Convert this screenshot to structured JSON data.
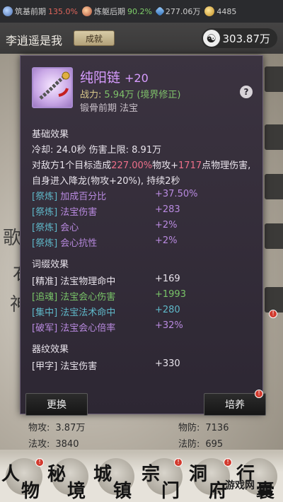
{
  "resources": [
    {
      "icon": "cultivation-stage-icon",
      "label": "筑基前期",
      "pct": "135.0%",
      "pct_color": "#e0665c"
    },
    {
      "icon": "body-refine-icon",
      "label": "炼躯后期",
      "pct": "90.2%",
      "pct_color": "#7fcf6a"
    },
    {
      "icon": "spirit-stone-icon",
      "label": "277.06万",
      "pct": "",
      "pct_color": ""
    },
    {
      "icon": "gold-coin-icon",
      "label": "4485",
      "pct": "",
      "pct_color": ""
    }
  ],
  "player": {
    "name": "李逍遥是我",
    "achievement_label": "成就",
    "power_value": "303.87万"
  },
  "item": {
    "name": "纯阳链",
    "level": "+20",
    "power_label": "战力:",
    "power_value": "5.94万",
    "power_note": "(境界修正)",
    "type_line": "锻骨前期  法宝",
    "help": "?"
  },
  "basic": {
    "title": "基础效果",
    "line1_prefix": "冷却:",
    "cooldown": "24.0秒",
    "damage_cap_label": "伤害上限:",
    "damage_cap": "8.91万",
    "desc_a": "对敌方1个目标造成",
    "desc_pct": "227.00%",
    "desc_b": "物攻+",
    "desc_flat": "1717",
    "desc_c": "点物理伤害,",
    "desc2": "自身进入降龙(物攻+20%), 持续2秒"
  },
  "refine_rows": [
    {
      "tag": "[祭炼]",
      "name": "加成百分比",
      "value": "+37.50%"
    },
    {
      "tag": "[祭炼]",
      "name": "法宝伤害",
      "value": "+283"
    },
    {
      "tag": "[祭炼]",
      "name": "会心",
      "value": "+2%"
    },
    {
      "tag": "[祭炼]",
      "name": "会心抗性",
      "value": "+2%"
    }
  ],
  "affix": {
    "title": "词缀效果",
    "rows": [
      {
        "tag": "[精准]",
        "name": "法宝物理命中",
        "value": "+169"
      },
      {
        "tag": "[追魂]",
        "name": "法宝会心伤害",
        "value": "+1993"
      },
      {
        "tag": "[集中]",
        "name": "法宝法术命中",
        "value": "+280"
      },
      {
        "tag": "[破军]",
        "name": "法宝会心倍率",
        "value": "+32%"
      }
    ]
  },
  "pattern": {
    "title": "器纹效果",
    "rows": [
      {
        "tag": "[甲字]",
        "name": "法宝伤害",
        "value": "+330"
      }
    ]
  },
  "buttons": {
    "exchange": "更换",
    "cultivate": "培养"
  },
  "bg_stats": {
    "phys_atk_label": "物攻:",
    "phys_atk": "3.87万",
    "phys_def_label": "物防:",
    "phys_def": "7136",
    "mag_atk_label": "法攻:",
    "mag_atk": "3840",
    "mag_def_label": "法防:",
    "mag_def": "695"
  },
  "nav": [
    {
      "c1": "人",
      "c2": "物"
    },
    {
      "c1": "秘",
      "c2": "境"
    },
    {
      "c1": "城",
      "c2": "镇"
    },
    {
      "c1": "宗",
      "c2": "门"
    },
    {
      "c1": "洞",
      "c2": "府"
    },
    {
      "c1": "行",
      "c2": "囊"
    }
  ],
  "watermark": "游戏网"
}
